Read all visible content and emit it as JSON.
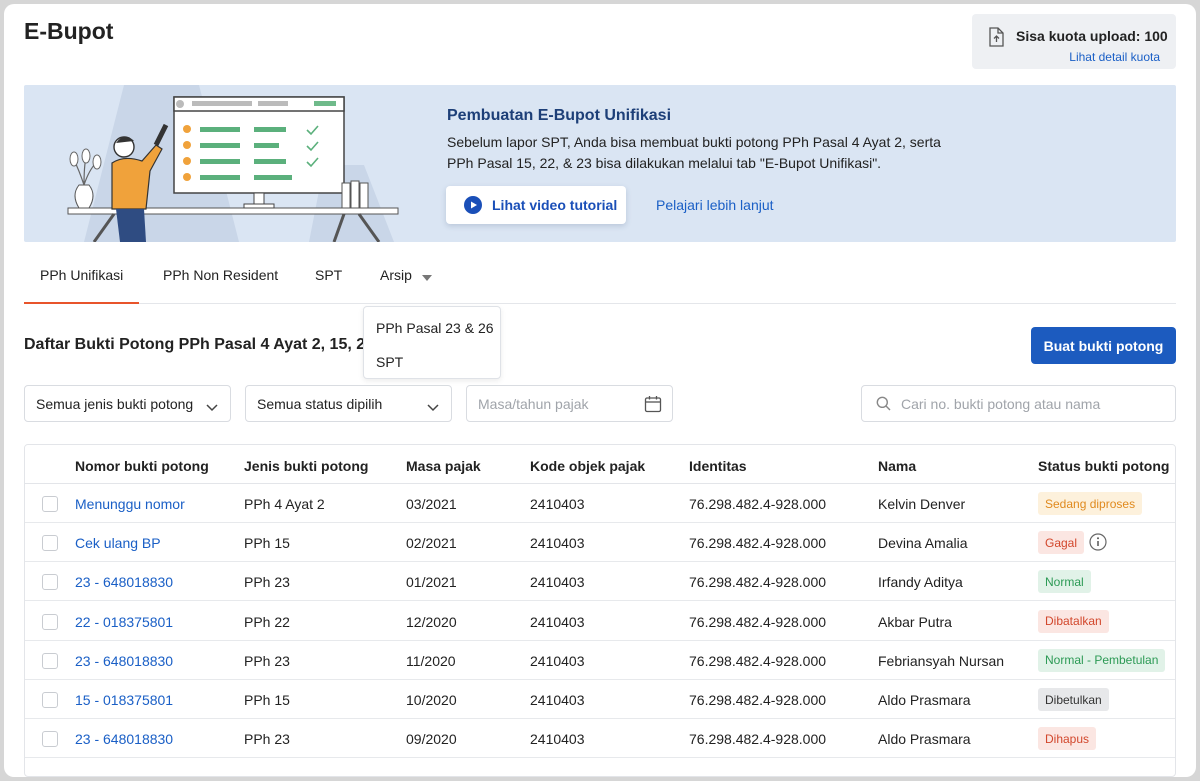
{
  "page": {
    "title": "E-Bupot"
  },
  "quota": {
    "label": "Sisa kuota upload: 100",
    "link": "Lihat detail kuota",
    "icon": "upload-document-icon"
  },
  "banner": {
    "title": "Pembuatan E-Bupot Unifikasi",
    "text": "Sebelum lapor SPT, Anda bisa membuat bukti potong PPh Pasal 4 Ayat 2, serta PPh Pasal 15, 22, & 23 bisa dilakukan melalui tab \"E-Bupot Unifikasi\".",
    "video_button": "Lihat video tutorial",
    "learn_link": "Pelajari lebih lanjut",
    "colors": {
      "background": "#dae5f3",
      "title": "#1d3f78",
      "accent": "#1a4fb8"
    }
  },
  "tabs": [
    {
      "label": "PPh Unifikasi",
      "active": true
    },
    {
      "label": "PPh Non Resident",
      "active": false
    },
    {
      "label": "SPT",
      "active": false
    },
    {
      "label": "Arsip",
      "active": false,
      "has_dropdown": true
    }
  ],
  "arsip_dropdown": {
    "options": [
      "PPh Pasal 23 & 26",
      "SPT"
    ]
  },
  "list": {
    "title": "Daftar Bukti Potong PPh Pasal 4 Ayat 2, 15, 22, & 23",
    "create_button": "Buat bukti potong"
  },
  "filters": {
    "jenis": "Semua jenis bukti potong",
    "status": "Semua status dipilih",
    "masa_placeholder": "Masa/tahun pajak",
    "search_placeholder": "Cari no. bukti potong atau nama"
  },
  "table": {
    "headers": {
      "nomor": "Nomor bukti potong",
      "jenis": "Jenis bukti potong",
      "masa": "Masa pajak",
      "kode": "Kode objek pajak",
      "identitas": "Identitas",
      "nama": "Nama",
      "status": "Status bukti potong"
    },
    "rows": [
      {
        "nomor": "Menunggu nomor",
        "jenis": "PPh 4 Ayat 2",
        "masa": "03/2021",
        "kode": "2410403",
        "identitas": "76.298.482.4-928.000",
        "nama": "Kelvin Denver",
        "status": "Sedang diproses",
        "status_bg": "#fdf1dc",
        "status_fg": "#e08a1e"
      },
      {
        "nomor": "Cek ulang BP",
        "jenis": "PPh 15",
        "masa": "02/2021",
        "kode": "2410403",
        "identitas": "76.298.482.4-928.000",
        "nama": "Devina Amalia",
        "status": "Gagal",
        "status_bg": "#fbe6e2",
        "status_fg": "#d2472c",
        "info": true
      },
      {
        "nomor": "23 - 648018830",
        "jenis": "PPh 23",
        "masa": "01/2021",
        "kode": "2410403",
        "identitas": "76.298.482.4-928.000",
        "nama": "Irfandy Aditya",
        "status": "Normal",
        "status_bg": "#e1f2e8",
        "status_fg": "#2c9a55"
      },
      {
        "nomor": "22 - 018375801",
        "jenis": "PPh 22",
        "masa": "12/2020",
        "kode": "2410403",
        "identitas": "76.298.482.4-928.000",
        "nama": "Akbar Putra",
        "status": "Dibatalkan",
        "status_bg": "#fbe6e2",
        "status_fg": "#d2472c"
      },
      {
        "nomor": "23 - 648018830",
        "jenis": "PPh 23",
        "masa": "11/2020",
        "kode": "2410403",
        "identitas": "76.298.482.4-928.000",
        "nama": "Febriansyah Nursan",
        "status": "Normal - Pembetulan",
        "status_bg": "#e1f2e8",
        "status_fg": "#2c9a55"
      },
      {
        "nomor": "15 - 018375801",
        "jenis": "PPh 15",
        "masa": "10/2020",
        "kode": "2410403",
        "identitas": "76.298.482.4-928.000",
        "nama": "Aldo Prasmara",
        "status": "Dibetulkan",
        "status_bg": "#e7e8ea",
        "status_fg": "#333333"
      },
      {
        "nomor": "23 - 648018830",
        "jenis": "PPh 23",
        "masa": "09/2020",
        "kode": "2410403",
        "identitas": "76.298.482.4-928.000",
        "nama": "Aldo Prasmara",
        "status": "Dihapus",
        "status_bg": "#fbe6e2",
        "status_fg": "#d2472c"
      }
    ]
  },
  "colors": {
    "primary": "#1c5bbf",
    "link": "#1a5fc6",
    "tab_underline": "#e8542b"
  }
}
